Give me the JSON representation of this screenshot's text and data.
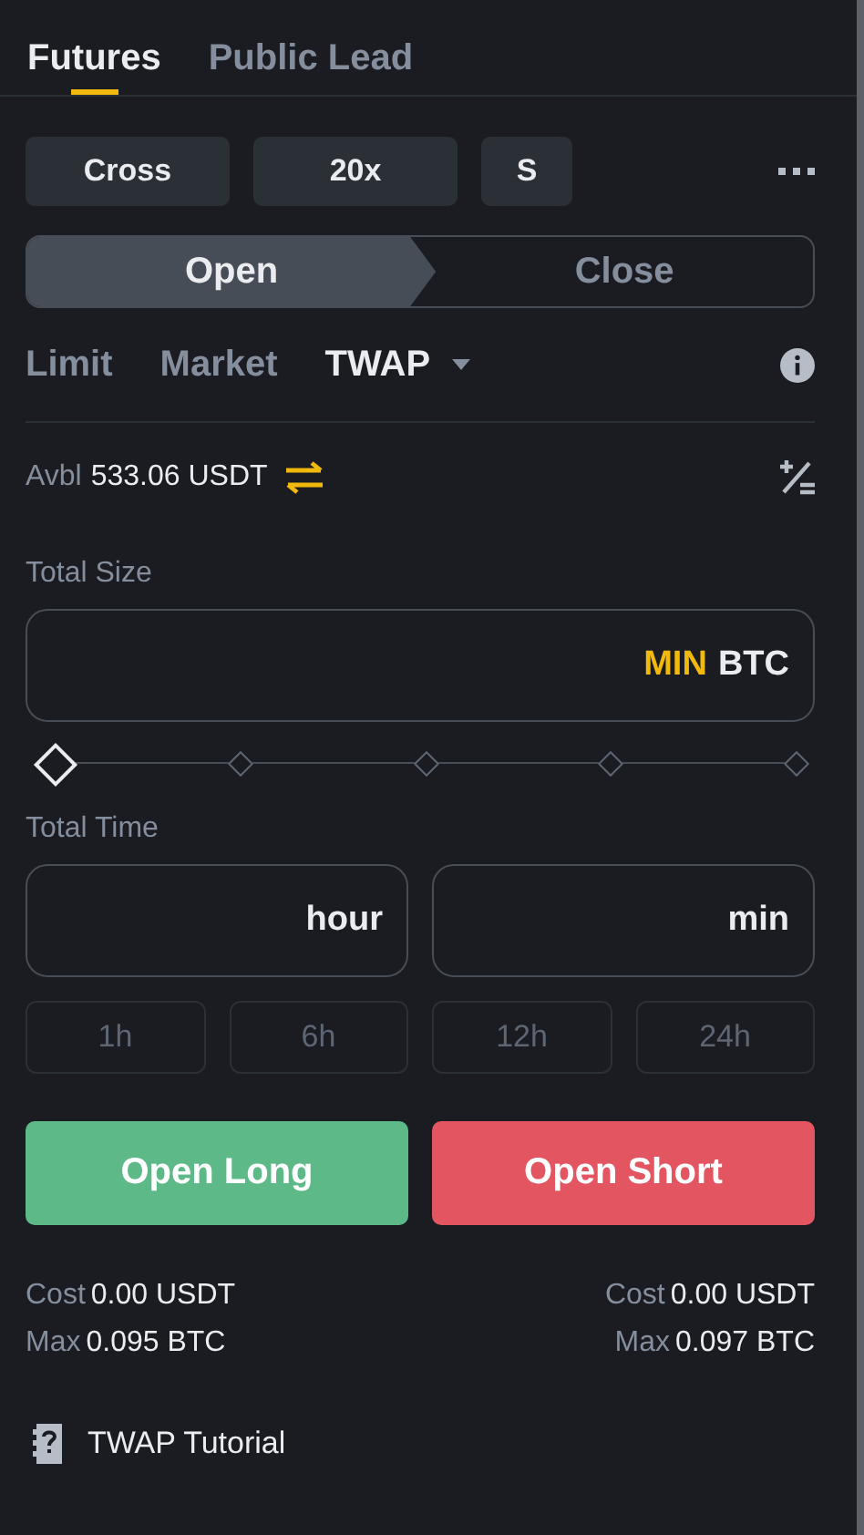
{
  "tabs": [
    {
      "label": "Futures",
      "selected": true
    },
    {
      "label": "Public Lead",
      "selected": false
    }
  ],
  "settings_buttons": [
    "Cross",
    "20x",
    "S"
  ],
  "position_switch": [
    {
      "label": "Open",
      "selected": true
    },
    {
      "label": "Close",
      "selected": false
    }
  ],
  "order_types": [
    {
      "label": "Limit",
      "selected": false,
      "dropdown": false
    },
    {
      "label": "Market",
      "selected": false,
      "dropdown": false
    },
    {
      "label": "TWAP",
      "selected": true,
      "dropdown": true
    }
  ],
  "available": {
    "label": "Avbl",
    "value": "533.06 USDT"
  },
  "total_size": {
    "label": "Total Size",
    "unit_hint": "MIN",
    "unit": "BTC"
  },
  "size_slider": {
    "level": 0
  },
  "total_time": {
    "label": "Total Time",
    "fields": [
      {
        "unit": "hour"
      },
      {
        "unit": "min"
      }
    ],
    "presets": [
      "1h",
      "6h",
      "12h",
      "24h"
    ]
  },
  "actions": [
    {
      "label": "Open Long",
      "kind": "long"
    },
    {
      "label": "Open Short",
      "kind": "short"
    }
  ],
  "summary": [
    {
      "cost_label": "Cost",
      "cost": "0.00 USDT",
      "max_label": "Max",
      "max": "0.095 BTC"
    },
    {
      "cost_label": "Cost",
      "cost": "0.00 USDT",
      "max_label": "Max",
      "max": "0.097 BTC"
    }
  ],
  "tutorial": {
    "label": "TWAP Tutorial"
  }
}
